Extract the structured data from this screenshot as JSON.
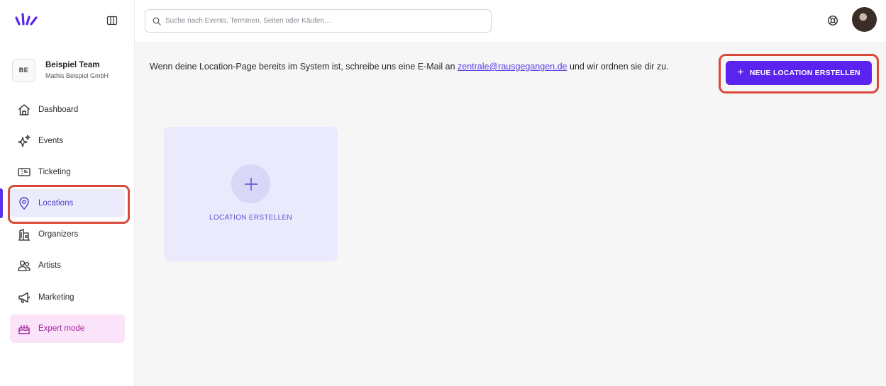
{
  "sidebar": {
    "team": {
      "initials": "BE",
      "name": "Beispiel Team",
      "company": "Mathis Beispiel GmbH"
    },
    "items": [
      {
        "label": "Dashboard",
        "icon": "home-icon"
      },
      {
        "label": "Events",
        "icon": "sparkle-icon"
      },
      {
        "label": "Ticketing",
        "icon": "ticket-icon"
      },
      {
        "label": "Locations",
        "icon": "map-pin-icon",
        "active": true
      },
      {
        "label": "Organizers",
        "icon": "building-icon"
      },
      {
        "label": "Artists",
        "icon": "users-icon"
      },
      {
        "label": "Marketing",
        "icon": "megaphone-icon"
      },
      {
        "label": "Expert mode",
        "icon": "cake-icon"
      }
    ]
  },
  "topbar": {
    "search_placeholder": "Suche nach Events, Terminen, Seiten oder Käufen…"
  },
  "main": {
    "info_before": "Wenn deine Location-Page bereits im System ist, schreibe uns eine E-Mail an ",
    "info_email": "zentrale@rausgegangen.de",
    "info_after": " und wir ordnen sie dir zu.",
    "primary_button": "NEUE LOCATION ERSTELLEN",
    "card_label": "LOCATION ERSTELLEN"
  },
  "colors": {
    "accent": "#5a23f0",
    "highlight": "#d8493b",
    "active_bg": "#ecebfb",
    "expert_bg": "#fbe3fa"
  }
}
